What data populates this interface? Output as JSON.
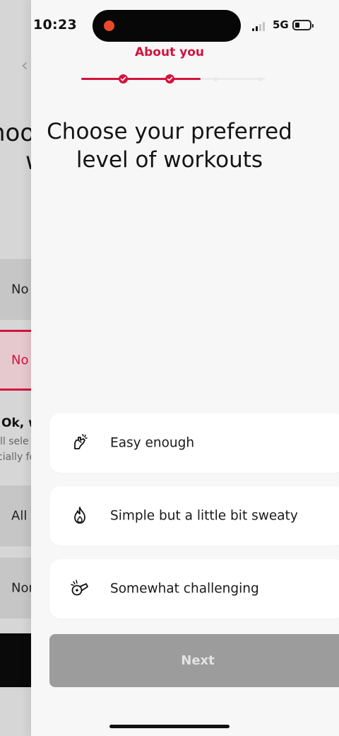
{
  "status_bar": {
    "time": "10:23",
    "network": "5G"
  },
  "background_screen": {
    "title_fragment_1": "hoo",
    "title_fragment_2": "w",
    "options": [
      "No",
      "No",
      "All",
      "Nor"
    ],
    "info_heading": "Ok, w",
    "info_line_1": "ll sele",
    "info_line_2": "cially fo"
  },
  "header": {
    "section_label": "About you",
    "progress": {
      "steps_total": 5,
      "steps_completed": 2,
      "fraction": 0.65
    }
  },
  "main": {
    "heading_line_1": "Choose your preferred",
    "heading_line_2": "level of workouts",
    "options": [
      {
        "label": "Easy enough",
        "icon": "rock-hand-icon"
      },
      {
        "label": "Simple but a little bit sweaty",
        "icon": "flame-icon"
      },
      {
        "label": "Somewhat challenging",
        "icon": "whistle-icon"
      }
    ]
  },
  "footer": {
    "next_label": "Next"
  },
  "colors": {
    "accent": "#d3133d",
    "button_disabled": "#9c9c9c",
    "background": "#f8f7f8"
  }
}
